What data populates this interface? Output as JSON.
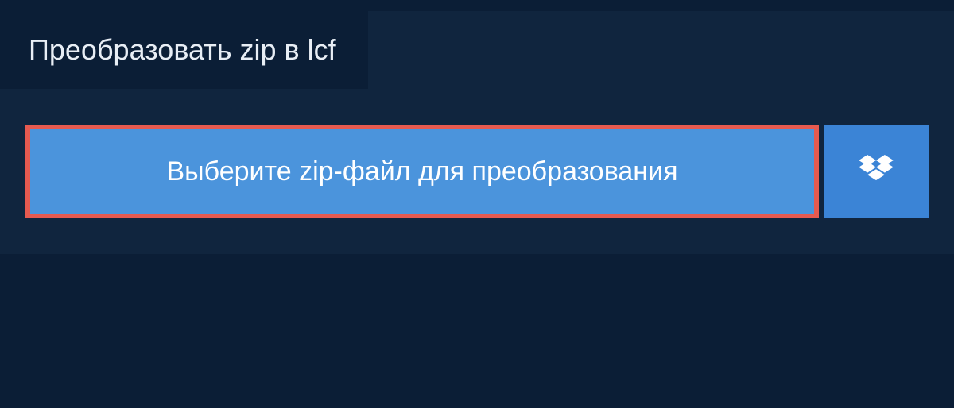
{
  "header": {
    "title": "Преобразовать zip в lcf"
  },
  "actions": {
    "select_file_label": "Выберите zip-файл для преобразования"
  },
  "colors": {
    "background_outer": "#0b1e36",
    "background_panel": "#10253e",
    "button_primary": "#4b94dc",
    "button_highlight_border": "#e65a50",
    "button_secondary": "#3b84d6",
    "text": "#ffffff"
  }
}
